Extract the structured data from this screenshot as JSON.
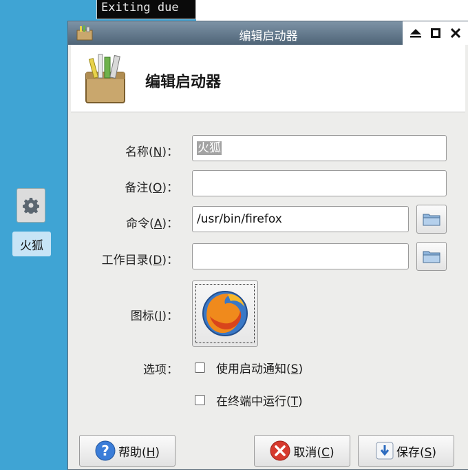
{
  "terminal": {
    "text": "Exiting due"
  },
  "desktop": {
    "launcher_label": "火狐"
  },
  "window": {
    "title": "编辑启动器",
    "controls": {
      "shade": "⏏",
      "maximize": "□",
      "close": "✕"
    }
  },
  "header": {
    "title": "编辑启动器"
  },
  "form": {
    "name": {
      "label_pre": "名称(",
      "mnemonic": "N",
      "label_post": ")：",
      "value": "火狐"
    },
    "comment": {
      "label_pre": "备注(",
      "mnemonic": "O",
      "label_post": ")：",
      "value": ""
    },
    "command": {
      "label_pre": "命令(",
      "mnemonic": "A",
      "label_post": ")：",
      "value": "/usr/bin/firefox"
    },
    "workdir": {
      "label_pre": "工作目录(",
      "mnemonic": "D",
      "label_post": ")：",
      "value": ""
    },
    "icon": {
      "label_pre": "图标(",
      "mnemonic": "I",
      "label_post": ")："
    },
    "options": {
      "label": "选项："
    },
    "startup_notify": {
      "label_pre": "使用启动通知(",
      "mnemonic": "S",
      "label_post": ")",
      "checked": false
    },
    "run_in_terminal": {
      "label_pre": "在终端中运行(",
      "mnemonic": "T",
      "label_post": ")",
      "checked": false
    }
  },
  "buttons": {
    "help": {
      "pre": "帮助(",
      "mnemonic": "H",
      "post": ")"
    },
    "cancel": {
      "pre": "取消(",
      "mnemonic": "C",
      "post": ")"
    },
    "save": {
      "pre": "保存(",
      "mnemonic": "S",
      "post": ")"
    }
  },
  "colors": {
    "desktop": "#3fa4d4",
    "titlebar": "#5e7488",
    "dialog_bg": "#ededeb"
  }
}
